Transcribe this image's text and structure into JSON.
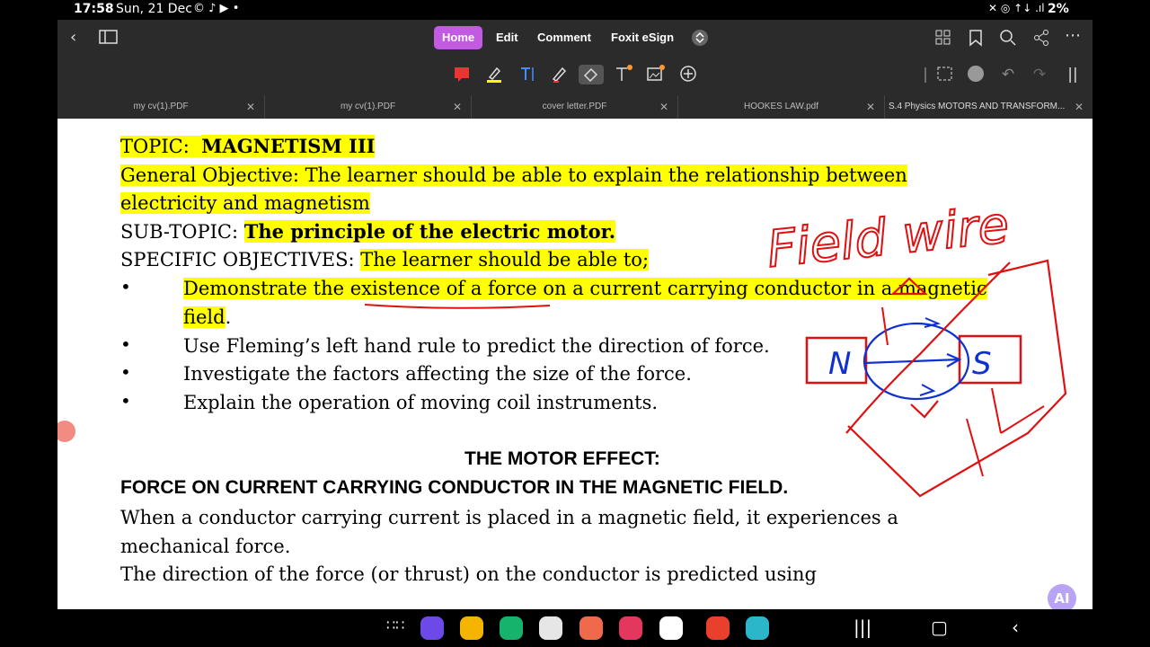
{
  "status_bar": {
    "time": "17:58",
    "date": "Sun, 21 Dec",
    "notif_icons": "© ♪ ▶ •",
    "right_icons": "✕ ◎ ↑↓ .ıl",
    "battery": "2%"
  },
  "menu": {
    "home": "Home",
    "edit": "Edit",
    "comment": "Comment",
    "esign": "Foxit eSign"
  },
  "file_tabs": [
    "my cv(1).PDF",
    "my cv(1).PDF",
    "cover letter.PDF",
    "HOOKES LAW.pdf",
    "S.4 Physics MOTORS AND TRANSFORM..."
  ],
  "document": {
    "topic_label": "TOPIC:",
    "topic_value": "MAGNETISM III",
    "gen_obj_1": "General Objective:  The learner should be able to explain the relationship between",
    "gen_obj_2": "electricity and magnetism",
    "subtopic_label": "SUB-TOPIC:",
    "subtopic_value": "The principle of the electric motor.",
    "specific_label": "SPECIFIC OBJECTIVES:",
    "specific_value": "The learner should be able to;",
    "bullet_char": "•",
    "bullets": [
      "Demonstrate the existence of a force on a current carrying conductor in a magnetic",
      "Use Fleming’s left hand rule to predict the direction of force.",
      "Investigate the factors affecting the size of the force.",
      "Explain the operation of moving coil instruments."
    ],
    "bullet1_cont": "field",
    "bullet1_period": ".",
    "heading1": "THE MOTOR EFFECT:",
    "heading2": "FORCE ON CURRENT CARRYING CONDUCTOR IN THE MAGNETIC FIELD.",
    "para1_1": "When a conductor carrying current is placed in a magnetic field, it experiences a",
    "para1_2": "mechanical force.",
    "para2": "The direction of the force (or thrust) on the conductor is predicted using"
  },
  "annotation": {
    "text": "Field wire",
    "n_label": "N",
    "s_label": "S",
    "ink_red": "#e01010",
    "ink_blue": "#1030d0"
  },
  "ai_label": "AI",
  "colors": {
    "accent": "#c35ae2",
    "highlight": "#ffff00",
    "toolbar": "#2b2b2b"
  }
}
